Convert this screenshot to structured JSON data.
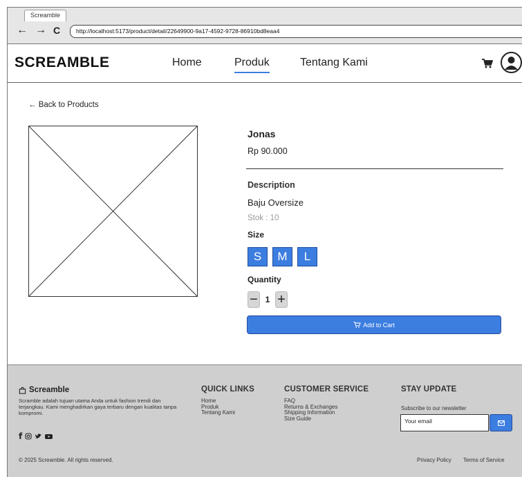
{
  "browser": {
    "tab_title": "Screamble",
    "back_glyph": "←",
    "forward_glyph": "→",
    "reload_glyph": "C",
    "url": "http://localhost:5173/product/detail/22649900-9a17-4592-9728-86910bd8eaa4"
  },
  "header": {
    "logo": "SCREAMBLE",
    "menu": [
      {
        "label": "Home",
        "active": false
      },
      {
        "label": "Produk",
        "active": true
      },
      {
        "label": "Tentang Kami",
        "active": false
      }
    ],
    "icons": [
      "cart-icon",
      "user-avatar-icon"
    ]
  },
  "product": {
    "back_link": "← Back to Products",
    "name": "Jonas",
    "price": "Rp 90.000",
    "description_heading": "Description",
    "description": "Baju Oversize",
    "stock": "Stok : 10",
    "size_heading": "Size",
    "sizes": [
      "S",
      "M",
      "L"
    ],
    "quantity_heading": "Quantity",
    "quantity": "1",
    "qty_minus": "−",
    "qty_plus": "+",
    "add_to_cart": "Add to Cart"
  },
  "footer": {
    "brand": "Screamble",
    "about": "Scramble adalah tujuan utama Anda untuk fashion trendi dan terjangkau. Kami menghadirkan gaya terbaru dengan kualitas tanpa kompromi.",
    "social_icons": [
      "facebook-icon",
      "instagram-icon",
      "twitter-icon",
      "youtube-icon"
    ],
    "quick_links_heading": "QUICK LINKS",
    "quick_links": [
      "Home",
      "Produk",
      "Tentang Kami"
    ],
    "customer_service_heading": "CUSTOMER SERVICE",
    "customer_service": [
      "FAQ",
      "Returns & Exchanges",
      "Shipping Information",
      "Size Guide"
    ],
    "stay_update_heading": "STAY UPDATE",
    "subscribe_text": "Subscribe to our newsletter",
    "email_value": "Your email",
    "copyright": "© 2025 Screamble. All rights reserved.",
    "privacy": "Privacy Policy",
    "terms": "Terms of Service"
  },
  "colors": {
    "accent": "#3c7de0",
    "footer_bg": "#cfcfcf",
    "chrome_bg": "#e6e6e6"
  }
}
